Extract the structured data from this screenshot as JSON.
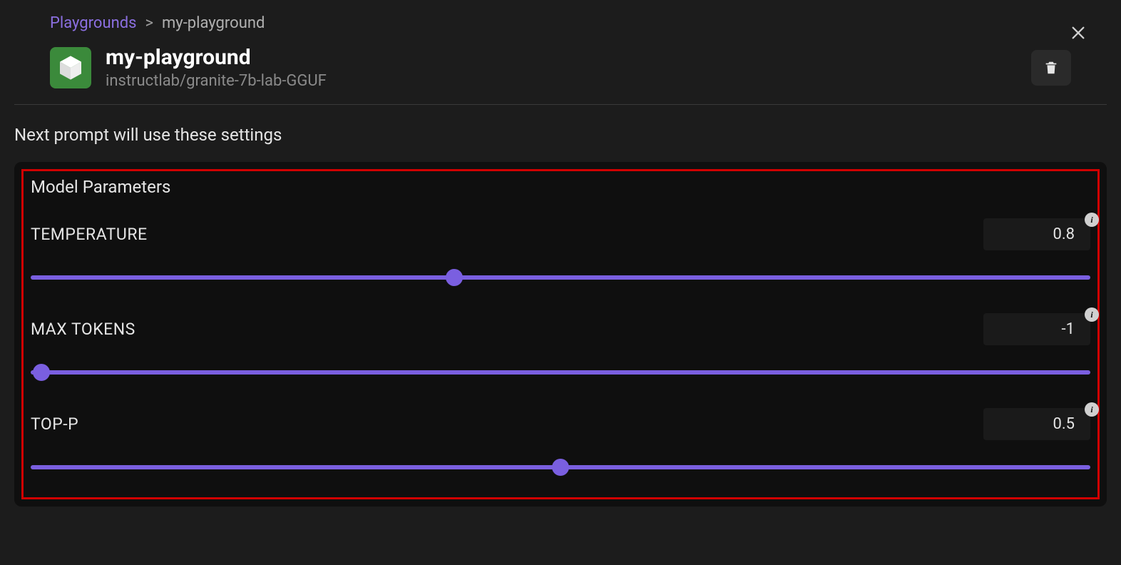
{
  "breadcrumb": {
    "root": "Playgrounds",
    "sep": ">",
    "current": "my-playground"
  },
  "header": {
    "title": "my-playground",
    "subtitle": "instructlab/granite-7b-lab-GGUF"
  },
  "message": "Next prompt will use these settings",
  "panel": {
    "title": "Model Parameters",
    "params": [
      {
        "label": "TEMPERATURE",
        "value": "0.8",
        "thumb_pct": 40
      },
      {
        "label": "MAX TOKENS",
        "value": "-1",
        "thumb_pct": 1
      },
      {
        "label": "TOP-P",
        "value": "0.5",
        "thumb_pct": 50
      }
    ]
  },
  "colors": {
    "accent": "#7a5fe0",
    "highlight_border": "#d10000",
    "icon_bg": "#3b8a3b"
  }
}
